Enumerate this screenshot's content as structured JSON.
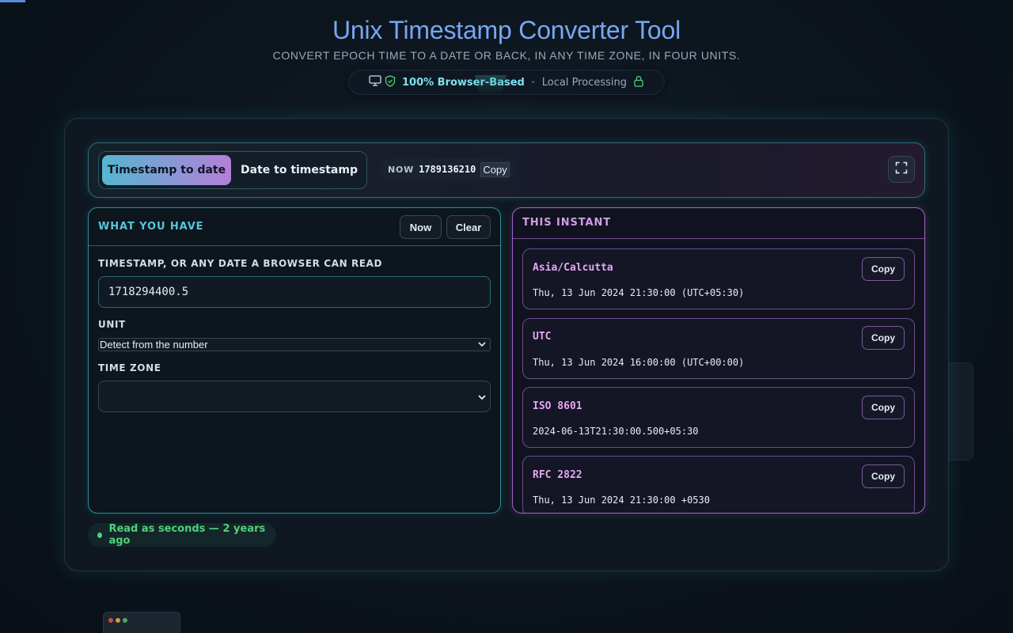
{
  "header": {
    "title": "Unix Timestamp Converter Tool",
    "subtitle": "CONVERT EPOCH TIME TO A DATE OR BACK, IN ANY TIME ZONE, IN FOUR UNITS.",
    "privacy_strong": "100% Browser-Based",
    "privacy_muted": "Local Processing",
    "separator": "•"
  },
  "toolbar": {
    "mode_active": "Timestamp to date",
    "mode_inactive": "Date to timestamp",
    "now_label": "NOW",
    "now_value": "1789136210",
    "now_copy": "Copy"
  },
  "input_panel": {
    "title": "WHAT YOU HAVE",
    "now_button": "Now",
    "clear_button": "Clear",
    "timestamp_label": "TIMESTAMP, OR ANY DATE A BROWSER CAN READ",
    "timestamp_value": "1718294400.5",
    "unit_label": "UNIT",
    "unit_selected": "Detect from the number",
    "timezone_label": "TIME ZONE",
    "timezone_selected": ""
  },
  "output_panel": {
    "title": "THIS INSTANT",
    "results": [
      {
        "name": "Asia/Calcutta",
        "value": "Thu, 13 Jun 2024 21:30:00 (UTC+05:30)",
        "copy": "Copy"
      },
      {
        "name": "UTC",
        "value": "Thu, 13 Jun 2024 16:00:00 (UTC+00:00)",
        "copy": "Copy"
      },
      {
        "name": "ISO 8601",
        "value": "2024-06-13T21:30:00.500+05:30",
        "copy": "Copy"
      },
      {
        "name": "RFC 2822",
        "value": "Thu, 13 Jun 2024 21:30:00 +0530",
        "copy": "Copy"
      }
    ]
  },
  "status": {
    "text": "Read as seconds — 2 years ago"
  },
  "colors": {
    "accent_cyan": "#56c6d8",
    "accent_purple": "#d49be8",
    "title_blue": "#79a6f3",
    "status_green": "#4fd07a"
  },
  "icons": {
    "privacy_left": [
      "monitor-icon",
      "shield-check-icon"
    ],
    "privacy_right": "lock-icon",
    "fullscreen": "expand-icon",
    "select": "chevron-down-icon"
  }
}
